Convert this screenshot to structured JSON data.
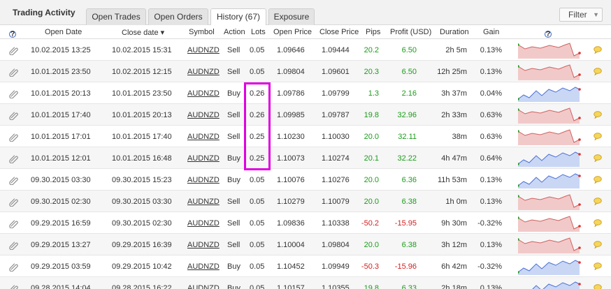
{
  "header": {
    "title": "Trading Activity"
  },
  "tabs": [
    {
      "label": "Open Trades"
    },
    {
      "label": "Open Orders"
    },
    {
      "label": "History (67)"
    },
    {
      "label": "Exposure"
    }
  ],
  "filter": {
    "label": "Filter"
  },
  "columns": {
    "open_date": "Open Date",
    "close_date": "Close date ▾",
    "symbol": "Symbol",
    "action": "Action",
    "lots": "Lots",
    "open_price": "Open Price",
    "close_price": "Close Price",
    "pips": "Pips",
    "profit": "Profit (USD)",
    "duration": "Duration",
    "gain": "Gain"
  },
  "help_glyph": "?",
  "colors": {
    "positive": "#1a9c1a",
    "negative": "#d42020",
    "highlight": "#e000e0",
    "spark_loss_fill": "#f2c9c9",
    "spark_gain_fill": "#c9d7f5"
  },
  "rows": [
    {
      "open": "10.02.2015 13:25",
      "close": "10.02.2015 15:31",
      "symbol": "AUDNZD",
      "action": "Sell",
      "lots": "0.05",
      "open_price": "1.09646",
      "close_price": "1.09444",
      "pips": "20.2",
      "profit": "6.50",
      "duration": "2h 5m",
      "gain": "0.13%",
      "spark": "loss",
      "up": true
    },
    {
      "open": "10.01.2015 23:50",
      "close": "10.02.2015 12:15",
      "symbol": "AUDNZD",
      "action": "Sell",
      "lots": "0.05",
      "open_price": "1.09804",
      "close_price": "1.09601",
      "pips": "20.3",
      "profit": "6.50",
      "duration": "12h 25m",
      "gain": "0.13%",
      "spark": "loss",
      "up": true
    },
    {
      "open": "10.01.2015 20:13",
      "close": "10.01.2015 23:50",
      "symbol": "AUDNZD",
      "action": "Buy",
      "lots": "0.26",
      "open_price": "1.09786",
      "close_price": "1.09799",
      "pips": "1.3",
      "profit": "2.16",
      "duration": "3h 37m",
      "gain": "0.04%",
      "spark": "gain",
      "up": true
    },
    {
      "open": "10.01.2015 17:40",
      "close": "10.01.2015 20:13",
      "symbol": "AUDNZD",
      "action": "Sell",
      "lots": "0.26",
      "open_price": "1.09985",
      "close_price": "1.09787",
      "pips": "19.8",
      "profit": "32.96",
      "duration": "2h 33m",
      "gain": "0.63%",
      "spark": "loss",
      "up": true
    },
    {
      "open": "10.01.2015 17:01",
      "close": "10.01.2015 17:40",
      "symbol": "AUDNZD",
      "action": "Sell",
      "lots": "0.25",
      "open_price": "1.10230",
      "close_price": "1.10030",
      "pips": "20.0",
      "profit": "32.11",
      "duration": "38m",
      "gain": "0.63%",
      "spark": "loss",
      "up": true
    },
    {
      "open": "10.01.2015 12:01",
      "close": "10.01.2015 16:48",
      "symbol": "AUDNZD",
      "action": "Buy",
      "lots": "0.25",
      "open_price": "1.10073",
      "close_price": "1.10274",
      "pips": "20.1",
      "profit": "32.22",
      "duration": "4h 47m",
      "gain": "0.64%",
      "spark": "gain",
      "up": true
    },
    {
      "open": "09.30.2015 03:30",
      "close": "09.30.2015 15:23",
      "symbol": "AUDNZD",
      "action": "Buy",
      "lots": "0.05",
      "open_price": "1.10076",
      "close_price": "1.10276",
      "pips": "20.0",
      "profit": "6.36",
      "duration": "11h 53m",
      "gain": "0.13%",
      "spark": "gain",
      "up": true
    },
    {
      "open": "09.30.2015 02:30",
      "close": "09.30.2015 03:30",
      "symbol": "AUDNZD",
      "action": "Sell",
      "lots": "0.05",
      "open_price": "1.10279",
      "close_price": "1.10079",
      "pips": "20.0",
      "profit": "6.38",
      "duration": "1h 0m",
      "gain": "0.13%",
      "spark": "loss",
      "up": true
    },
    {
      "open": "09.29.2015 16:59",
      "close": "09.30.2015 02:30",
      "symbol": "AUDNZD",
      "action": "Sell",
      "lots": "0.05",
      "open_price": "1.09836",
      "close_price": "1.10338",
      "pips": "-50.2",
      "profit": "-15.95",
      "duration": "9h 30m",
      "gain": "-0.32%",
      "spark": "loss",
      "up": false
    },
    {
      "open": "09.29.2015 13:27",
      "close": "09.29.2015 16:39",
      "symbol": "AUDNZD",
      "action": "Sell",
      "lots": "0.05",
      "open_price": "1.10004",
      "close_price": "1.09804",
      "pips": "20.0",
      "profit": "6.38",
      "duration": "3h 12m",
      "gain": "0.13%",
      "spark": "loss",
      "up": true
    },
    {
      "open": "09.29.2015 03:59",
      "close": "09.29.2015 10:42",
      "symbol": "AUDNZD",
      "action": "Buy",
      "lots": "0.05",
      "open_price": "1.10452",
      "close_price": "1.09949",
      "pips": "-50.3",
      "profit": "-15.96",
      "duration": "6h 42m",
      "gain": "-0.32%",
      "spark": "gain",
      "up": false
    },
    {
      "open": "09.28.2015 14:04",
      "close": "09.28.2015 16:22",
      "symbol": "AUDNZD",
      "action": "Buy",
      "lots": "0.05",
      "open_price": "1.10157",
      "close_price": "1.10355",
      "pips": "19.8",
      "profit": "6.33",
      "duration": "2h 18m",
      "gain": "0.13%",
      "spark": "gain",
      "up": true
    }
  ]
}
